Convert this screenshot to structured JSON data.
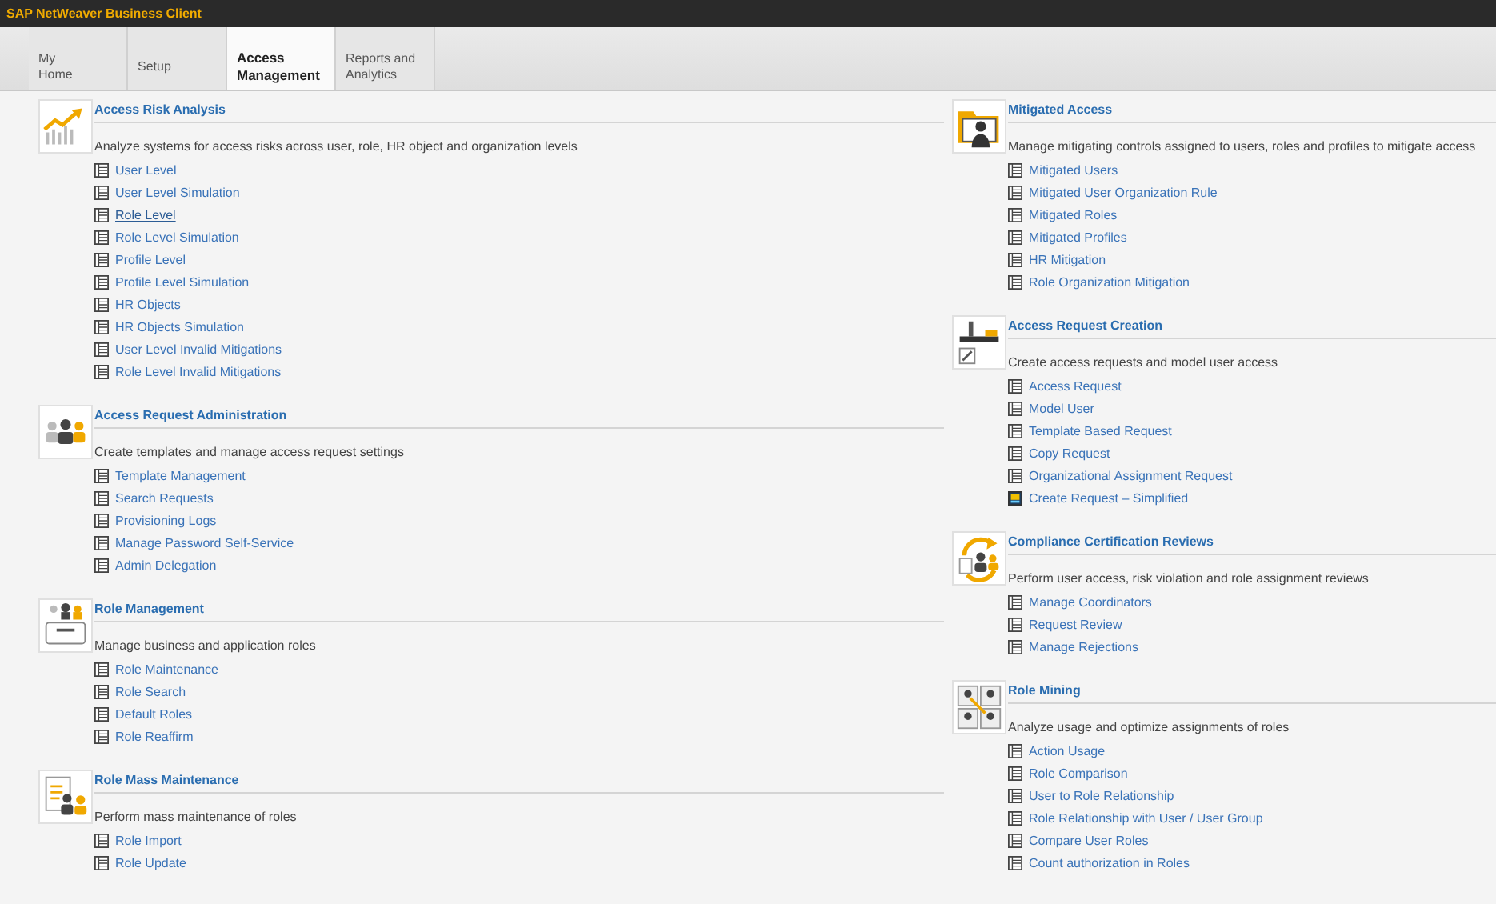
{
  "window": {
    "title": "SAP NetWeaver Business Client"
  },
  "tabs": [
    {
      "lines": [
        "My",
        "Home"
      ],
      "selected": false
    },
    {
      "lines": [
        "Setup"
      ],
      "selected": false
    },
    {
      "lines": [
        "Access",
        "Management"
      ],
      "selected": true
    },
    {
      "lines": [
        "Reports and",
        "Analytics"
      ],
      "selected": false
    }
  ],
  "columns": [
    {
      "sections": [
        {
          "kind": "chart",
          "title": "Access Risk Analysis",
          "description": "Analyze systems for access risks across user, role, HR object and organization levels",
          "items": [
            {
              "label": "User Level",
              "hovered": false
            },
            {
              "label": "User Level Simulation",
              "hovered": false
            },
            {
              "label": "Role Level",
              "hovered": true
            },
            {
              "label": "Role Level Simulation",
              "hovered": false
            },
            {
              "label": "Profile Level",
              "hovered": false
            },
            {
              "label": "Profile Level Simulation",
              "hovered": false
            },
            {
              "label": "HR Objects",
              "hovered": false
            },
            {
              "label": "HR Objects Simulation",
              "hovered": false
            },
            {
              "label": "User Level Invalid Mitigations",
              "hovered": false
            },
            {
              "label": "Role Level Invalid Mitigations",
              "hovered": false
            }
          ]
        },
        {
          "kind": "people",
          "title": "Access Request Administration",
          "description": "Create templates and manage access request settings",
          "items": [
            {
              "label": "Template Management"
            },
            {
              "label": "Search Requests"
            },
            {
              "label": "Provisioning Logs"
            },
            {
              "label": "Manage Password Self-Service"
            },
            {
              "label": "Admin Delegation"
            }
          ]
        },
        {
          "kind": "people-desk",
          "title": "Role Management",
          "description": "Manage business and application roles",
          "items": [
            {
              "label": "Role Maintenance"
            },
            {
              "label": "Role Search"
            },
            {
              "label": "Default Roles"
            },
            {
              "label": "Role Reaffirm"
            }
          ]
        },
        {
          "kind": "document-people",
          "title": "Role Mass Maintenance",
          "description": "Perform mass maintenance of roles",
          "items": [
            {
              "label": "Role Import"
            },
            {
              "label": "Role Update"
            }
          ]
        }
      ]
    },
    {
      "sections": [
        {
          "kind": "folder-person",
          "title": "Mitigated Access",
          "description": "Manage mitigating controls assigned to users, roles and profiles to mitigate access",
          "items": [
            {
              "label": "Mitigated Users"
            },
            {
              "label": "Mitigated User Organization Rule"
            },
            {
              "label": "Mitigated Roles"
            },
            {
              "label": "Mitigated Profiles"
            },
            {
              "label": "HR Mitigation"
            },
            {
              "label": "Role Organization Mitigation"
            }
          ]
        },
        {
          "kind": "request",
          "title": "Access Request Creation",
          "description": "Create access requests and model user access",
          "items": [
            {
              "label": "Access Request",
              "kind": "document"
            },
            {
              "label": "Model User",
              "kind": "document"
            },
            {
              "label": "Template Based Request",
              "kind": "document"
            },
            {
              "label": "Copy Request",
              "kind": "document"
            },
            {
              "label": "Organizational Assignment Request",
              "kind": "document"
            },
            {
              "label": "Create Request – Simplified",
              "kind": "app"
            }
          ]
        },
        {
          "kind": "cycle-people",
          "title": "Compliance Certification Reviews",
          "description": "Perform user access, risk violation and role assignment reviews",
          "items": [
            {
              "label": "Manage Coordinators"
            },
            {
              "label": "Request Review"
            },
            {
              "label": "Manage Rejections"
            }
          ]
        },
        {
          "kind": "people-grid",
          "title": "Role Mining",
          "description": "Analyze usage and optimize assignments of roles",
          "items": [
            {
              "label": "Action Usage"
            },
            {
              "label": "Role Comparison"
            },
            {
              "label": "User to Role Relationship"
            },
            {
              "label": "Role Relationship with User / User Group"
            },
            {
              "label": "Compare User Roles"
            },
            {
              "label": "Count authorization in Roles"
            }
          ]
        }
      ]
    }
  ]
}
